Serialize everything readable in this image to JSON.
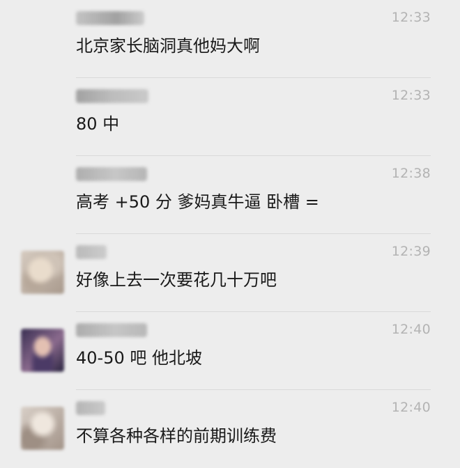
{
  "messages": [
    {
      "sender": "",
      "time": "12:33",
      "text": "北京家长脑洞真他妈大啊",
      "has_avatar": false
    },
    {
      "sender": "",
      "time": "12:33",
      "text": "80 中",
      "has_avatar": false
    },
    {
      "sender": "",
      "time": "12:38",
      "text": "高考 +50 分  爹妈真牛逼 卧槽 =",
      "has_avatar": false
    },
    {
      "sender": "",
      "time": "12:39",
      "text": "好像上去一次要花几十万吧",
      "has_avatar": true
    },
    {
      "sender": "",
      "time": "12:40",
      "text": "40-50 吧 他北坡",
      "has_avatar": true
    },
    {
      "sender": "",
      "time": "12:40",
      "text": "不算各种各样的前期训练费",
      "has_avatar": true
    }
  ],
  "colors": {
    "background": "#ededed",
    "text": "#191919",
    "timestamp": "#b3b3b3",
    "divider": "#d9d9d9"
  }
}
